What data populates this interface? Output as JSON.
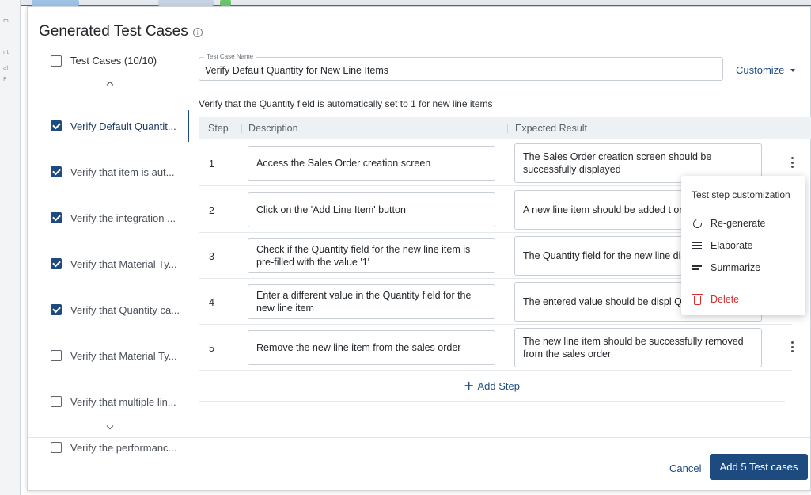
{
  "background": {
    "accent": "#3a6fb0",
    "side_fragments": [
      "m",
      "nt",
      "al",
      "F"
    ]
  },
  "dialog": {
    "title": "Generated Test Cases",
    "info_icon": "info-icon"
  },
  "sidebar": {
    "header_label": "Test Cases (10/10)",
    "header_checked": false,
    "items": [
      {
        "label": "Verify Default Quantit...",
        "checked": true,
        "active": true
      },
      {
        "label": "Verify that item is aut...",
        "checked": true,
        "active": false
      },
      {
        "label": "Verify the integration ...",
        "checked": true,
        "active": false
      },
      {
        "label": "Verify that Material Ty...",
        "checked": true,
        "active": false
      },
      {
        "label": "Verify that Quantity ca...",
        "checked": true,
        "active": false
      },
      {
        "label": "Verify that Material Ty...",
        "checked": false,
        "active": false
      },
      {
        "label": "Verify that multiple lin...",
        "checked": false,
        "active": false
      },
      {
        "label": "Verify the performanc...",
        "checked": false,
        "active": false
      }
    ]
  },
  "test_case": {
    "name_label": "Test Case Name",
    "name_value": "Verify Default Quantity for New Line Items",
    "customize_label": "Customize",
    "objective": "Verify that the Quantity field is automatically set to 1 for new line items"
  },
  "table": {
    "headers": {
      "step": "Step",
      "description": "Description",
      "expected": "Expected Result"
    },
    "steps": [
      {
        "num": "1",
        "description": "Access the Sales Order creation screen",
        "expected": "The Sales Order creation screen should be successfully displayed"
      },
      {
        "num": "2",
        "description": "Click on the 'Add Line Item' button",
        "expected": "A new line item should be added t order"
      },
      {
        "num": "3",
        "description": "Check if the Quantity field for the new line item is pre-filled with the value '1'",
        "expected": "The Quantity field for the new line display '1'"
      },
      {
        "num": "4",
        "description": "Enter a different value in the Quantity field for the new line item",
        "expected": "The entered value should be displ Quantity field"
      },
      {
        "num": "5",
        "description": "Remove the new line item from the sales order",
        "expected": "The new line item should be successfully removed from the sales order"
      }
    ],
    "add_step_label": "Add Step"
  },
  "context_menu": {
    "title": "Test step customization",
    "items": [
      {
        "label": "Re-generate",
        "icon": "regenerate-icon"
      },
      {
        "label": "Elaborate",
        "icon": "elaborate-icon"
      },
      {
        "label": "Summarize",
        "icon": "summarize-icon"
      }
    ],
    "delete_label": "Delete",
    "delete_icon": "trash-icon",
    "delete_color": "#d32f2f"
  },
  "footer": {
    "cancel_label": "Cancel",
    "primary_label": "Add 5 Test cases",
    "primary_color": "#1d4b80"
  }
}
